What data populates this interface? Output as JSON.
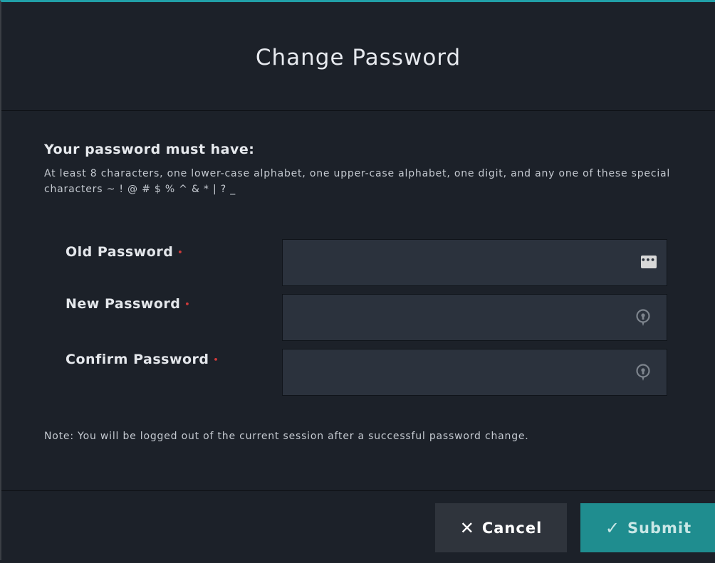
{
  "dialog": {
    "title": "Change Password"
  },
  "requirements": {
    "heading": "Your password must have:",
    "text": "At least 8 characters, one lower-case alphabet, one upper-case alphabet, one digit, and any one of these special characters ~ ! @ # $ % ^ & * | ? _"
  },
  "fields": [
    {
      "label": "Old Password",
      "value": "",
      "icon": "password-dots-icon",
      "required_marker": "•"
    },
    {
      "label": "New Password",
      "value": "",
      "icon": "key-icon",
      "required_marker": "•"
    },
    {
      "label": "Confirm Password",
      "value": "",
      "icon": "key-icon",
      "required_marker": "•"
    }
  ],
  "dots_glyph": "•••|",
  "note": "Note: You will be logged out of the current session after a successful password change.",
  "buttons": {
    "cancel_glyph": "✕",
    "cancel_label": "Cancel",
    "submit_glyph": "✓",
    "submit_label": "Submit"
  },
  "colors": {
    "accent": "#21a0a8",
    "background": "#1c2129",
    "field": "#2b323d",
    "required": "#d03a3a",
    "submit": "#1f8d8f"
  }
}
